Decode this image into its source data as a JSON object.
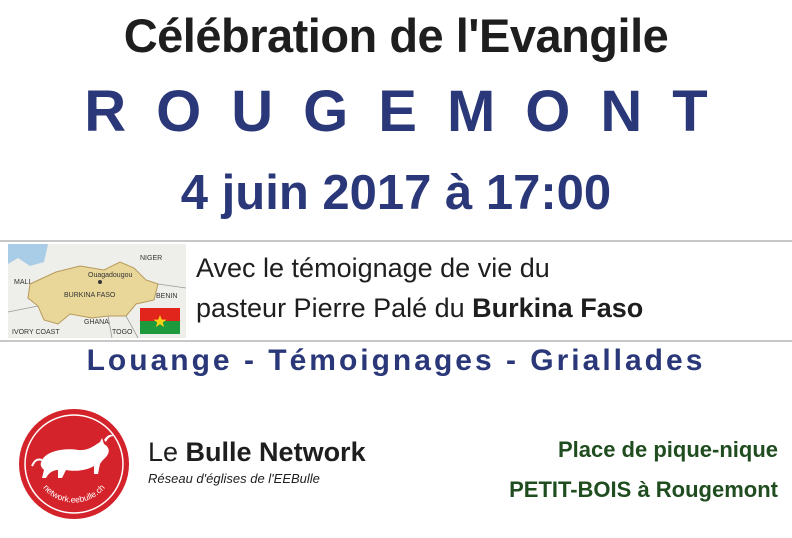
{
  "header": {
    "title": "Célébration de l'Evangile",
    "town": "ROUGEMONT",
    "datetime": "4 juin 2017 à 17:00"
  },
  "map": {
    "labels": {
      "niger": "NIGER",
      "ouagadougou": "Ouagadougou",
      "mali": "MALI",
      "burkina": "BURKINA FASO",
      "benin": "BENIN",
      "ghana": "GHANA",
      "ivory_coast": "IVORY COAST",
      "togo": "TOGO"
    },
    "colors": {
      "land": "#e9d79a",
      "water": "#a9cde6",
      "neighbours": "#eeeeea"
    }
  },
  "flag": {
    "colors": {
      "red": "#e2251c",
      "green": "#1c9a3c",
      "star": "#f7d116"
    }
  },
  "testimony": {
    "line1": "Avec le témoignage de vie du",
    "line2_prefix": "pasteur Pierre Palé du ",
    "line2_bold": "Burkina Faso"
  },
  "activities": "Louange - Témoignages - Griallades",
  "logo": {
    "url_text": "network.eebulle.ch",
    "colors": {
      "circle": "#d4232a",
      "bull": "#ffffff"
    }
  },
  "brand": {
    "name_light": "Le ",
    "name_bold": "Bulle Network",
    "tagline": "Réseau d'églises de l'EEBulle"
  },
  "venue": {
    "line1": "Place de pique-nique",
    "line2": "PETIT-BOIS à Rougemont"
  },
  "colors": {
    "blue": "#2a3879",
    "dark": "#1e1e1e",
    "green": "#1f4d1f"
  }
}
